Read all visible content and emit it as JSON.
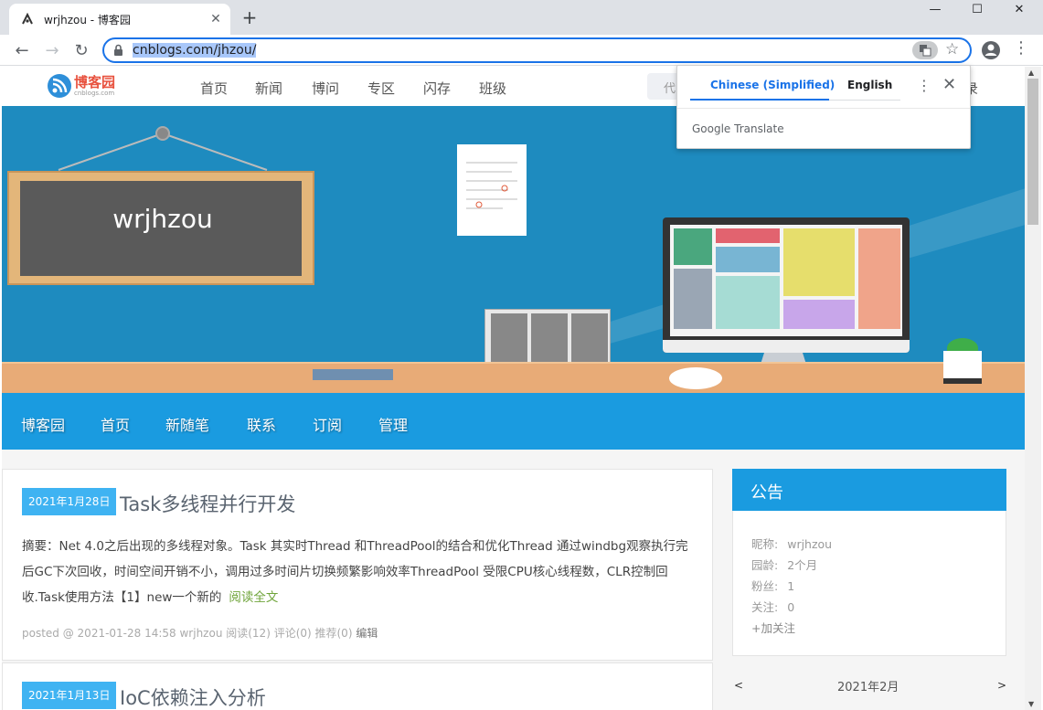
{
  "browser": {
    "tab_title": "wrjhzou - 博客园",
    "tab_close": "✕",
    "new_tab": "+",
    "url_host": "cnblogs.com/jhzou/",
    "win_min": "—",
    "win_max": "☐",
    "win_close": "✕"
  },
  "translate": {
    "lang_active": "Chinese (Simplified)",
    "lang_other": "English",
    "footer": "Google Translate"
  },
  "site_nav": {
    "logo_text": "博客园",
    "logo_sub": "cnblogs.com",
    "links": [
      "首页",
      "新闻",
      "博问",
      "专区",
      "闪存",
      "班级"
    ],
    "search_placeholder": "代",
    "login_fragment": "录"
  },
  "banner": {
    "board_text": "wrjhzou"
  },
  "blog_nav": {
    "items": [
      "博客园",
      "首页",
      "新随笔",
      "联系",
      "订阅",
      "管理"
    ]
  },
  "posts": [
    {
      "date": "2021年1月28日",
      "title": "Task多线程并行开发",
      "summary": "摘要：Net 4.0之后出现的多线程对象。Task 其实时Thread 和ThreadPool的结合和优化Thread 通过windbg观察执行完后GC下次回收，时间空间开销不小，调用过多时间片切换频繁影响效率ThreadPool 受限CPU核心线程数，CLR控制回收.Task使用方法【1】new一个新的",
      "read_more": "阅读全文",
      "meta": "posted @ 2021-01-28 14:58 wrjhzou 阅读(12) 评论(0) 推荐(0)",
      "edit": "编辑"
    },
    {
      "date": "2021年1月13日",
      "title": "IoC依赖注入分析"
    }
  ],
  "notice": {
    "title": "公告",
    "rows": [
      {
        "label": "昵称:",
        "value": "wrjhzou"
      },
      {
        "label": "园龄:",
        "value": "2个月"
      },
      {
        "label": "粉丝:",
        "value": "1"
      },
      {
        "label": "关注:",
        "value": "0"
      }
    ],
    "follow": "+加关注"
  },
  "calendar": {
    "prev": "<",
    "title": "2021年2月",
    "next": ">"
  },
  "colors": {
    "accent": "#1a9be0",
    "date_badge": "#3fb3f2",
    "banner_bg": "#1e8bbf"
  }
}
